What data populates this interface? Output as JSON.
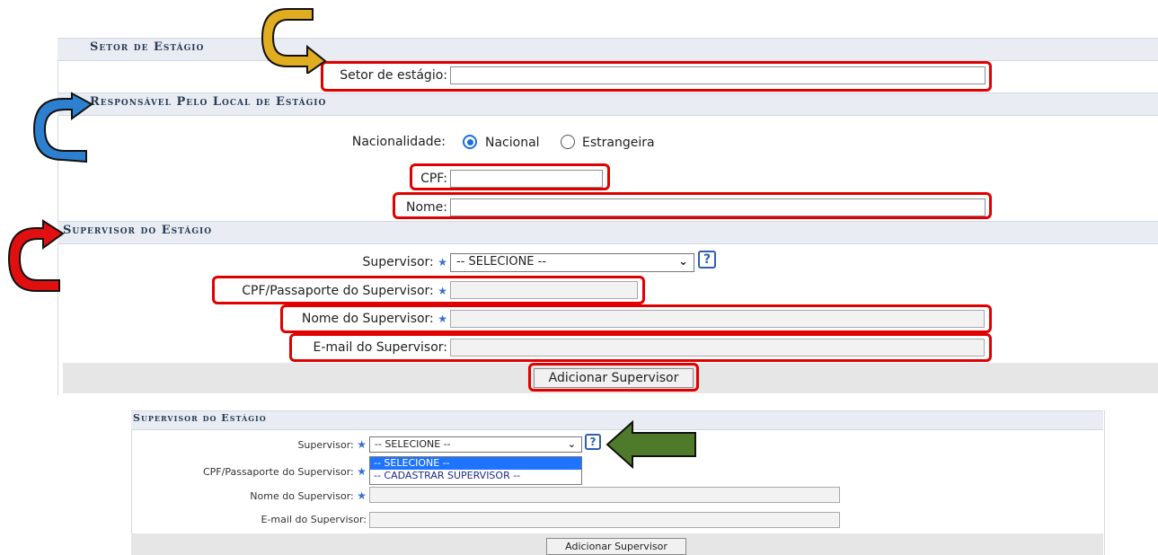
{
  "sections": {
    "setor": {
      "title": "Setor de Estágio",
      "setor_label": "Setor de estágio:"
    },
    "responsavel": {
      "title": "Responsável Pelo Local de Estágio",
      "nacionalidade_label": "Nacionalidade:",
      "option_nacional": "Nacional",
      "option_estrangeira": "Estrangeira",
      "selected": "Nacional",
      "cpf_label": "CPF:",
      "nome_label": "Nome:"
    },
    "supervisor": {
      "title": "Supervisor do Estágio",
      "supervisor_label": "Supervisor:",
      "supervisor_selected": "-- SELECIONE --",
      "cpf_label": "CPF/Passaporte do Supervisor:",
      "nome_label": "Nome do Supervisor:",
      "email_label": "E-mail do Supervisor:",
      "add_button": "Adicionar Supervisor",
      "help_icon": "?"
    }
  },
  "inset": {
    "title": "Supervisor do Estágio",
    "supervisor_label": "Supervisor:",
    "supervisor_selected": "-- SELECIONE --",
    "dropdown_options": [
      "-- SELECIONE --",
      "-- CADASTRAR SUPERVISOR --"
    ],
    "highlighted_option": "-- SELECIONE --",
    "cpf_label": "CPF/Passaporte do Supervisor:",
    "nome_label": "Nome do Supervisor:",
    "email_label": "E-mail do Supervisor:",
    "add_button": "Adicionar Supervisor",
    "help_icon": "?"
  },
  "annotations": {
    "highlight_color": "#e00000",
    "arrow_colors": {
      "gold": "#e0ac20",
      "blue": "#2d7fd0",
      "red": "#e01010",
      "green": "#4f7a2a"
    },
    "icons": [
      "curved-arrow-gold-icon",
      "curved-arrow-blue-icon",
      "curved-arrow-red-icon",
      "arrow-left-green-icon",
      "help-icon",
      "required-star-icon",
      "chevron-down-icon"
    ]
  }
}
